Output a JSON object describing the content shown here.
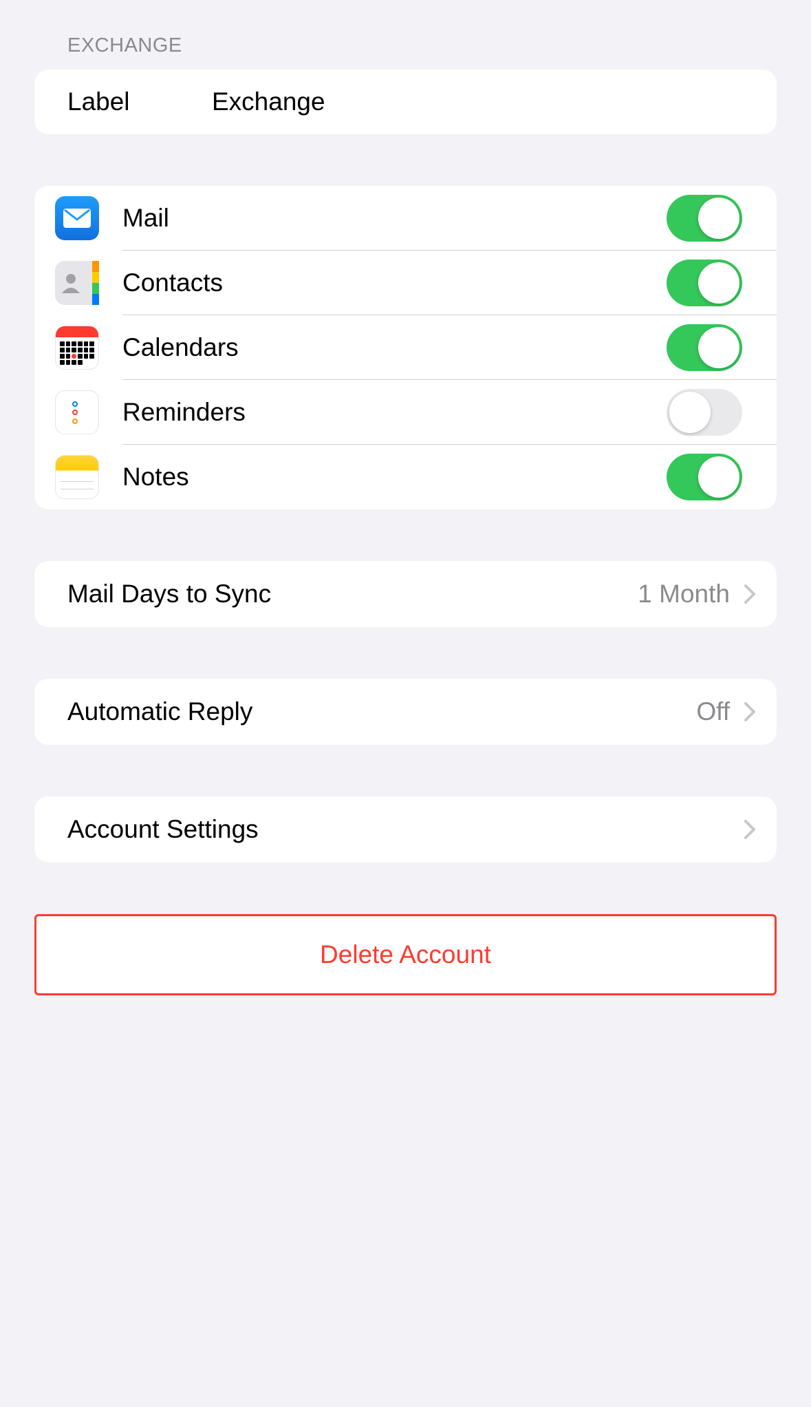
{
  "section_header": "Exchange",
  "label_row": {
    "key": "Label",
    "value": "Exchange"
  },
  "services": [
    {
      "name": "Mail",
      "on": true,
      "icon": "mail-icon"
    },
    {
      "name": "Contacts",
      "on": true,
      "icon": "contacts-icon"
    },
    {
      "name": "Calendars",
      "on": true,
      "icon": "calendar-icon"
    },
    {
      "name": "Reminders",
      "on": false,
      "icon": "reminders-icon"
    },
    {
      "name": "Notes",
      "on": true,
      "icon": "notes-icon"
    }
  ],
  "mail_days_to_sync": {
    "label": "Mail Days to Sync",
    "value": "1 Month"
  },
  "automatic_reply": {
    "label": "Automatic Reply",
    "value": "Off"
  },
  "account_settings": {
    "label": "Account Settings"
  },
  "delete_account": {
    "label": "Delete Account"
  }
}
